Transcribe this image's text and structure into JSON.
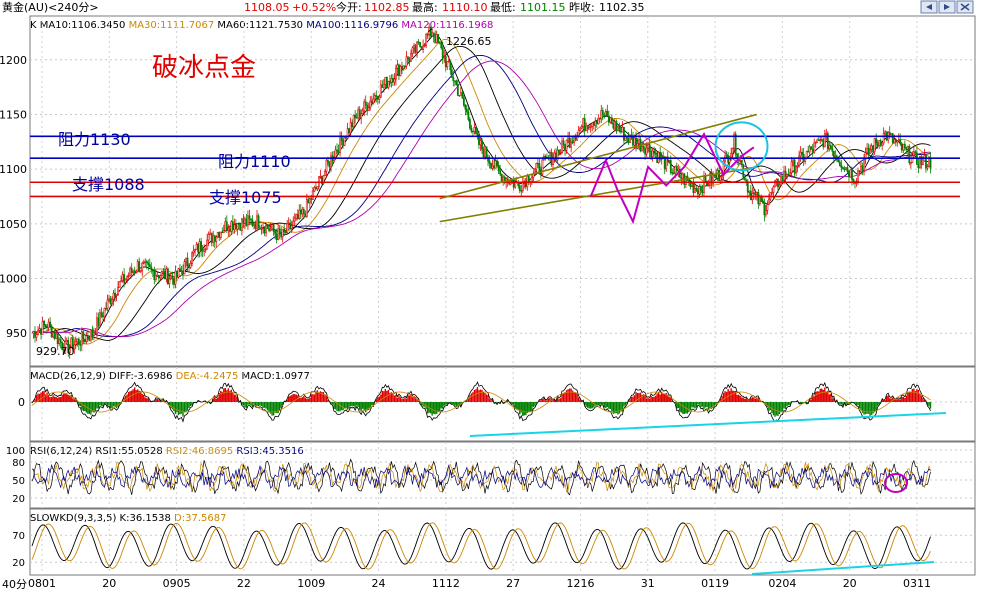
{
  "header": {
    "symbol": "黄金(AU)<240分>",
    "price": "1108.05",
    "change": "+0.52%",
    "open_label": "今开:",
    "open": "1102.85",
    "high_label": "最高:",
    "high": "1110.10",
    "low_label": "最低:",
    "low": "1101.15",
    "prev_label": "昨收:",
    "prev": "1102.35"
  },
  "ma_legend": [
    {
      "label": "K",
      "color": "#000000"
    },
    {
      "label": "MA10:1106.3450",
      "color": "#000000"
    },
    {
      "label": "MA30:1111.7067",
      "color": "#cc8800"
    },
    {
      "label": "MA60:1121.7530",
      "color": "#000000"
    },
    {
      "label": "MA100:1116.9796",
      "color": "#000080"
    },
    {
      "label": "MA120:1116.1968",
      "color": "#b000b0"
    }
  ],
  "annotations": {
    "brand": "破冰点金",
    "resistance_1130": "阻力1130",
    "resistance_1110": "阻力1110",
    "support_1088": "支撑1088",
    "support_1075": "支撑1075",
    "peak_label": "1226.65",
    "low_label": "929.70"
  },
  "macd_legend": [
    {
      "label": "MACD(26,12,9)",
      "color": "#000000"
    },
    {
      "label": "DIFF:-3.6986",
      "color": "#000000"
    },
    {
      "label": "DEA:-4.2475",
      "color": "#cc8800"
    },
    {
      "label": "MACD:1.0977",
      "color": "#000000"
    }
  ],
  "rsi_legend": [
    {
      "label": "RSI(6,12,24)",
      "color": "#000000"
    },
    {
      "label": "RSI1:55.0528",
      "color": "#000000"
    },
    {
      "label": "RSI2:46.8695",
      "color": "#cc8800"
    },
    {
      "label": "RSI3:45.3516",
      "color": "#000080"
    }
  ],
  "kd_legend": [
    {
      "label": "SLOWKD(9,3,3,5)",
      "color": "#000000"
    },
    {
      "label": "K:36.1538",
      "color": "#000000"
    },
    {
      "label": "D:37.5687",
      "color": "#cc8800"
    }
  ],
  "period_label": "40分",
  "chart_data": [
    {
      "type": "candlestick",
      "panel": "price",
      "ylim": [
        920,
        1240
      ],
      "ytick_labels": [
        "950",
        "1000",
        "1050",
        "1100",
        "1150",
        "1200"
      ],
      "yticks": [
        950,
        1000,
        1050,
        1100,
        1150,
        1200
      ],
      "x_labels": [
        "0801",
        "20",
        "0905",
        "22",
        "1009",
        "24",
        "1112",
        "27",
        "1216",
        "31",
        "0119",
        "0204",
        "20",
        "0311"
      ],
      "path": [
        [
          0,
          950
        ],
        [
          10,
          958
        ],
        [
          22,
          936
        ],
        [
          40,
          950
        ],
        [
          55,
          990
        ],
        [
          70,
          1012
        ],
        [
          80,
          1006
        ],
        [
          95,
          1000
        ],
        [
          110,
          1028
        ],
        [
          130,
          1050
        ],
        [
          150,
          1052
        ],
        [
          165,
          1038
        ],
        [
          180,
          1060
        ],
        [
          200,
          1115
        ],
        [
          215,
          1148
        ],
        [
          235,
          1180
        ],
        [
          255,
          1210
        ],
        [
          265,
          1226.65
        ],
        [
          280,
          1180
        ],
        [
          295,
          1125
        ],
        [
          310,
          1095
        ],
        [
          322,
          1085
        ],
        [
          335,
          1100
        ],
        [
          350,
          1118
        ],
        [
          365,
          1140
        ],
        [
          378,
          1150
        ],
        [
          395,
          1128
        ],
        [
          410,
          1118
        ],
        [
          425,
          1098
        ],
        [
          440,
          1082
        ],
        [
          455,
          1095
        ],
        [
          465,
          1125
        ],
        [
          475,
          1080
        ],
        [
          485,
          1065
        ],
        [
          495,
          1090
        ],
        [
          510,
          1110
        ],
        [
          525,
          1128
        ],
        [
          535,
          1108
        ],
        [
          545,
          1092
        ],
        [
          555,
          1118
        ],
        [
          565,
          1132
        ],
        [
          575,
          1120
        ],
        [
          585,
          1108
        ],
        [
          595,
          1106
        ]
      ],
      "peak": 1226.65,
      "low": 929.7,
      "horizontal_lines": [
        {
          "value": 1130,
          "color": "#0000c0",
          "label_key": "resistance_1130"
        },
        {
          "value": 1110,
          "color": "#0000c0",
          "label_key": "resistance_1110"
        },
        {
          "value": 1088,
          "color": "#e00000",
          "label_key": "support_1088"
        },
        {
          "value": 1075,
          "color": "#e00000",
          "label_key": "support_1075"
        }
      ],
      "channel_lines": [
        {
          "from": [
            270,
            1073
          ],
          "to": [
            480,
            1150
          ],
          "color": "#808000"
        },
        {
          "from": [
            270,
            1052
          ],
          "to": [
            480,
            1102
          ],
          "color": "#808000"
        }
      ],
      "magenta_pattern": [
        [
          370,
          1075
        ],
        [
          380,
          1108
        ],
        [
          388,
          1080
        ],
        [
          398,
          1052
        ],
        [
          408,
          1102
        ],
        [
          420,
          1085
        ],
        [
          432,
          1102
        ],
        [
          445,
          1132
        ],
        [
          458,
          1095
        ],
        [
          470,
          1112
        ],
        [
          478,
          1120
        ]
      ],
      "highlight_circle": {
        "x": 450,
        "y": 1130
      },
      "ma_series": [
        {
          "name": "MA10",
          "color": "#000000",
          "lag": 2
        },
        {
          "name": "MA30",
          "color": "#cc8800",
          "lag": 6
        },
        {
          "name": "MA60",
          "color": "#000000",
          "lag": 12
        },
        {
          "name": "MA100",
          "color": "#000080",
          "lag": 20
        },
        {
          "name": "MA120",
          "color": "#b000b0",
          "lag": 25
        }
      ]
    },
    {
      "type": "bar+line",
      "panel": "macd",
      "ytick_labels": [
        "0"
      ],
      "yticks": [
        0
      ]
    },
    {
      "type": "line",
      "panel": "rsi",
      "ylim": [
        10,
        100
      ],
      "ytick_labels": [
        "100",
        "80",
        "50",
        "20"
      ],
      "yticks": [
        100,
        80,
        50,
        20
      ]
    },
    {
      "type": "line",
      "panel": "slowkd",
      "ylim": [
        0,
        100
      ],
      "ytick_labels": [
        "70",
        "20"
      ],
      "yticks": [
        70,
        20
      ]
    }
  ]
}
